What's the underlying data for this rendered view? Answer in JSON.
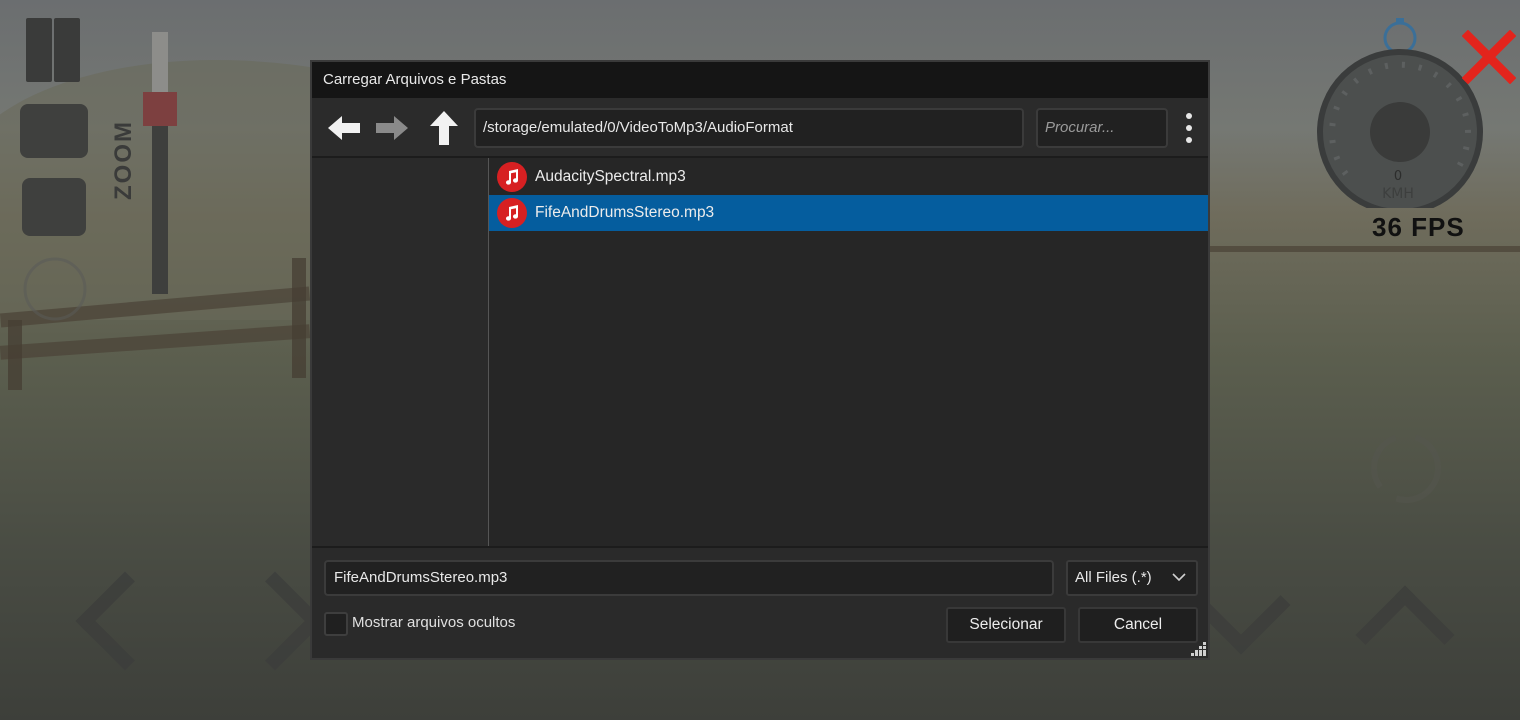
{
  "hud": {
    "zoom_label": "ZOOM",
    "fps_text": "36 FPS",
    "speed_unit": "KMH",
    "speed_value": "0"
  },
  "dialog": {
    "title": "Carregar Arquivos e Pastas",
    "path": "/storage/emulated/0/VideoToMp3/AudioFormat",
    "search_placeholder": "Procurar...",
    "files": [
      {
        "name": "AudacitySpectral.mp3",
        "icon": "music-note-icon",
        "selected": false
      },
      {
        "name": "FifeAndDrumsStereo.mp3",
        "icon": "music-note-icon",
        "selected": true
      }
    ],
    "filename_value": "FifeAndDrumsStereo.mp3",
    "filter_value": "All Files (.*)",
    "show_hidden_label": "Mostrar arquivos ocultos",
    "show_hidden_checked": false,
    "select_button": "Selecionar",
    "cancel_button": "Cancel"
  },
  "colors": {
    "selection": "#055d9e",
    "music_icon": "#d72022",
    "close_x": "#e3241c"
  }
}
